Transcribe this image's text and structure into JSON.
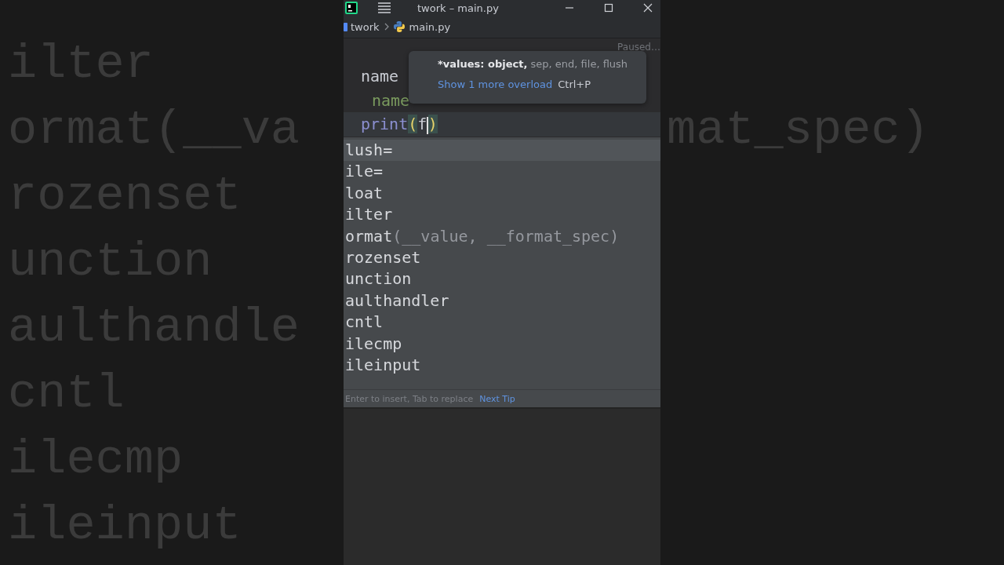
{
  "background": {
    "left_lines": [
      "ilter",
      "ormat(__va",
      "rozenset",
      "unction",
      "aulthandle",
      "cntl",
      "ilecmp",
      "ileinput"
    ],
    "right_lines": [
      "mat_spec)"
    ]
  },
  "window": {
    "title": "twork – main.py"
  },
  "breadcrumb": [
    {
      "label": "twork",
      "kind": "folder"
    },
    {
      "label": "main.py",
      "kind": "python"
    }
  ],
  "editor": {
    "status": "Paused…",
    "lines": [
      {
        "current": false,
        "tokens": [
          {
            "text": "name",
            "kind": "ident"
          }
        ]
      },
      {
        "current": false,
        "tokens": [
          {
            "text": "name",
            "kind": "param"
          }
        ]
      },
      {
        "current": true,
        "tokens": [
          {
            "text": "print",
            "kind": "builtin"
          },
          {
            "text": "(",
            "kind": "bracket"
          },
          {
            "text": "f",
            "kind": "ident",
            "cursor": true
          },
          {
            "text": ")",
            "kind": "bracket"
          }
        ]
      }
    ]
  },
  "parameter_info": {
    "params": [
      {
        "text": "*values: object,",
        "current": true
      },
      {
        "text": "sep, end, file, flush",
        "current": false
      }
    ],
    "link": "Show 1 more overload",
    "shortcut": "Ctrl+P"
  },
  "completion": {
    "items": [
      {
        "text": "lush=",
        "selected": true
      },
      {
        "text": "ile=",
        "selected": false
      },
      {
        "text": "loat",
        "selected": false
      },
      {
        "text": "ilter",
        "selected": false
      },
      {
        "text": "ormat",
        "tail": "(__value, __format_spec)",
        "selected": false
      },
      {
        "text": "rozenset",
        "selected": false
      },
      {
        "text": "unction",
        "selected": false
      },
      {
        "text": "aulthandler",
        "selected": false
      },
      {
        "text": "cntl",
        "selected": false
      },
      {
        "text": "ilecmp",
        "selected": false
      },
      {
        "text": "ileinput",
        "selected": false
      }
    ],
    "hint": "Enter to insert, Tab to replace",
    "tip_link": "Next Tip"
  }
}
